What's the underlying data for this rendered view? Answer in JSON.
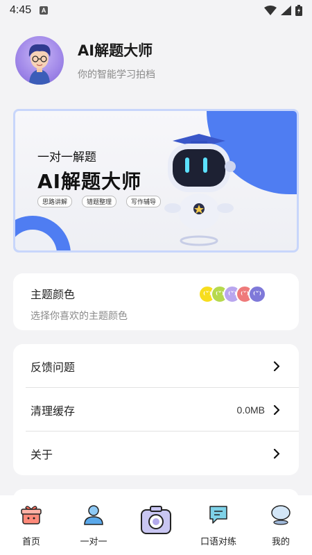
{
  "status_bar": {
    "time": "4:45",
    "notification_badge": "A"
  },
  "profile": {
    "title": "AI解题大师",
    "subtitle": "你的智能学习拍档"
  },
  "banner": {
    "line1": "一对一解题",
    "line2": "AI解题大师",
    "tags": [
      "思路讲解",
      "错题整理",
      "写作辅导"
    ],
    "accent": "#4f7df2"
  },
  "theme": {
    "title": "主题颜色",
    "subtitle": "选择你喜欢的主题颜色",
    "swatch_colors": [
      "#f7dd1e",
      "#b6d94d",
      "#b9a6ee",
      "#ee7a7a",
      "#7f79d9"
    ]
  },
  "menu": {
    "items": [
      {
        "label": "反馈问题",
        "value": ""
      },
      {
        "label": "清理缓存",
        "value": "0.0MB"
      },
      {
        "label": "关于",
        "value": ""
      }
    ]
  },
  "tabs": [
    {
      "label": "首页",
      "icon": "gift-box-icon"
    },
    {
      "label": "一对一",
      "icon": "person-icon"
    },
    {
      "label": "",
      "icon": "camera-icon"
    },
    {
      "label": "口语对练",
      "icon": "chat-bubble-icon"
    },
    {
      "label": "我的",
      "icon": "profile-icon"
    }
  ]
}
